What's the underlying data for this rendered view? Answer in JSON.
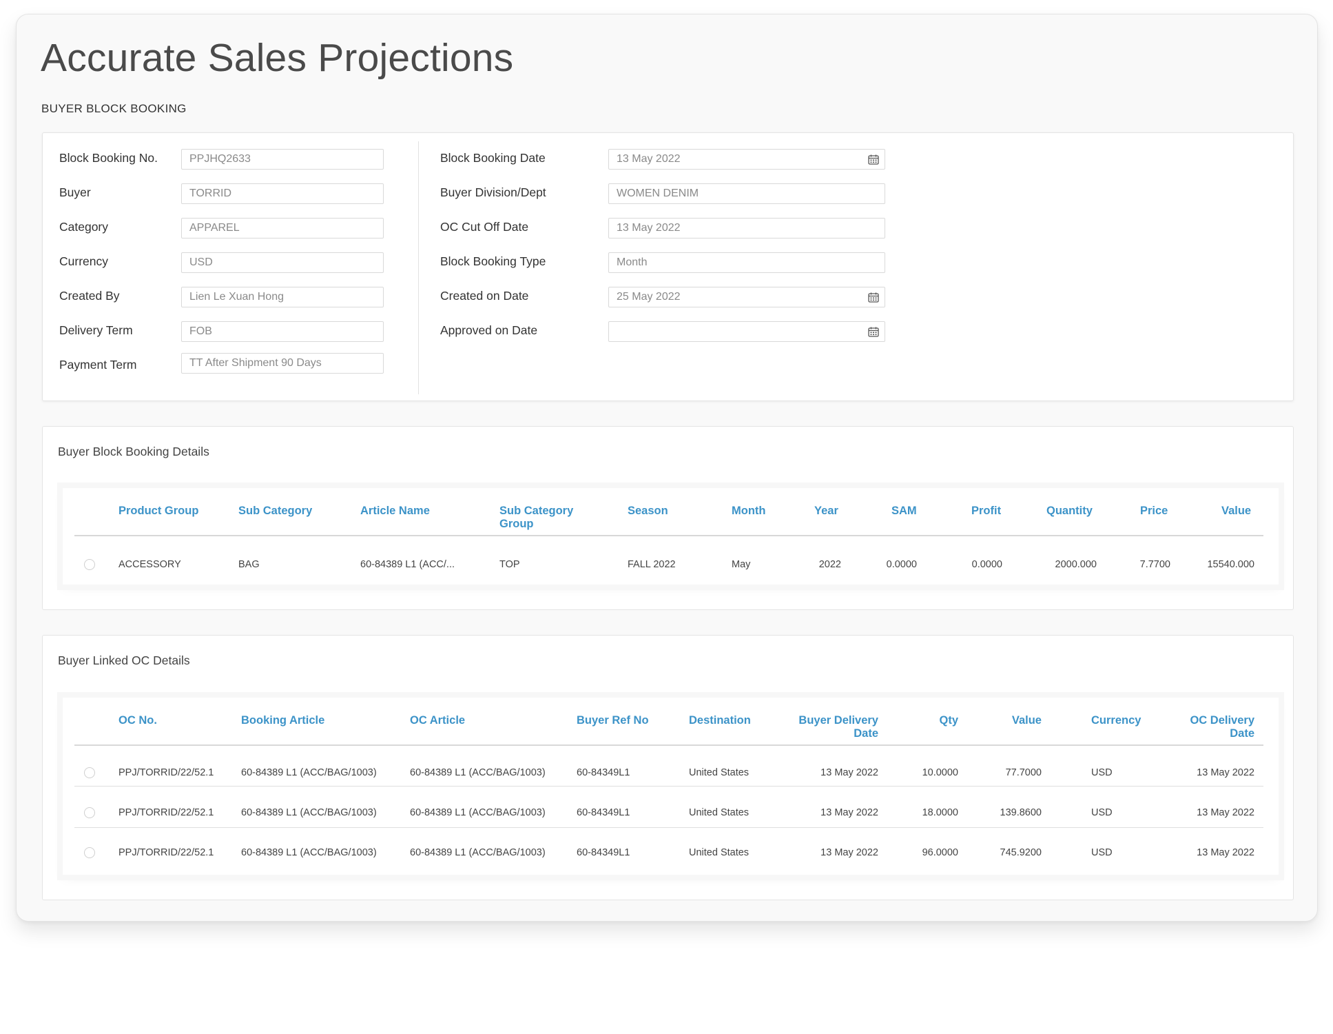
{
  "page": {
    "title": "Accurate Sales Projections",
    "section_caption": "BUYER BLOCK BOOKING"
  },
  "form": {
    "left": [
      {
        "label": "Block Booking No.",
        "value": "PPJHQ2633"
      },
      {
        "label": "Buyer",
        "value": "TORRID"
      },
      {
        "label": "Category",
        "value": "APPAREL"
      },
      {
        "label": "Currency",
        "value": "USD"
      },
      {
        "label": "Created By",
        "value": "Lien Le Xuan Hong"
      },
      {
        "label": "Delivery Term",
        "value": "FOB"
      },
      {
        "label": "Payment Term",
        "value": "TT After Shipment 90 Days"
      }
    ],
    "right": [
      {
        "label": "Block Booking Date",
        "value": "13 May 2022",
        "icon": "calendar-icon"
      },
      {
        "label": "Buyer Division/Dept",
        "value": "WOMEN DENIM"
      },
      {
        "label": "OC Cut Off Date",
        "value": "13 May 2022"
      },
      {
        "label": "Block Booking Type",
        "value": "Month"
      },
      {
        "label": "Created on Date",
        "value": "25 May 2022",
        "icon": "calendar-icon"
      },
      {
        "label": "Approved on Date",
        "value": "",
        "icon": "calendar-icon"
      }
    ]
  },
  "booking_details": {
    "heading": "Buyer Block Booking Details",
    "columns": [
      "Product Group",
      "Sub Category",
      "Article Name",
      "Sub Category Group",
      "Season",
      "Month",
      "Year",
      "SAM",
      "Profit",
      "Quantity",
      "Price",
      "Value"
    ],
    "rows": [
      [
        "ACCESSORY",
        "BAG",
        "60-84389 L1 (ACC/...",
        "TOP",
        "FALL 2022",
        "May",
        "2022",
        "0.0000",
        "0.0000",
        "2000.000",
        "7.7700",
        "15540.000"
      ]
    ]
  },
  "oc_details": {
    "heading": "Buyer Linked OC Details",
    "columns": [
      "OC No.",
      "Booking Article",
      "OC Article",
      "Buyer Ref No",
      "Destination",
      "Buyer Delivery Date",
      "Qty",
      "Value",
      "Currency",
      "OC Delivery Date"
    ],
    "rows": [
      [
        "PPJ/TORRID/22/52.1",
        "60-84389 L1 (ACC/BAG/1003)",
        "60-84389 L1 (ACC/BAG/1003)",
        "60-84349L1",
        "United States",
        "13 May 2022",
        "10.0000",
        "77.7000",
        "USD",
        "13 May 2022"
      ],
      [
        "PPJ/TORRID/22/52.1",
        "60-84389 L1 (ACC/BAG/1003)",
        "60-84389 L1 (ACC/BAG/1003)",
        "60-84349L1",
        "United States",
        "13 May 2022",
        "18.0000",
        "139.8600",
        "USD",
        "13 May 2022"
      ],
      [
        "PPJ/TORRID/22/52.1",
        "60-84389 L1 (ACC/BAG/1003)",
        "60-84389 L1 (ACC/BAG/1003)",
        "60-84349L1",
        "United States",
        "13 May 2022",
        "96.0000",
        "745.9200",
        "USD",
        "13 May 2022"
      ]
    ]
  },
  "colors": {
    "header_text": "#3c93c8",
    "card_background": "#f9f9f9"
  }
}
